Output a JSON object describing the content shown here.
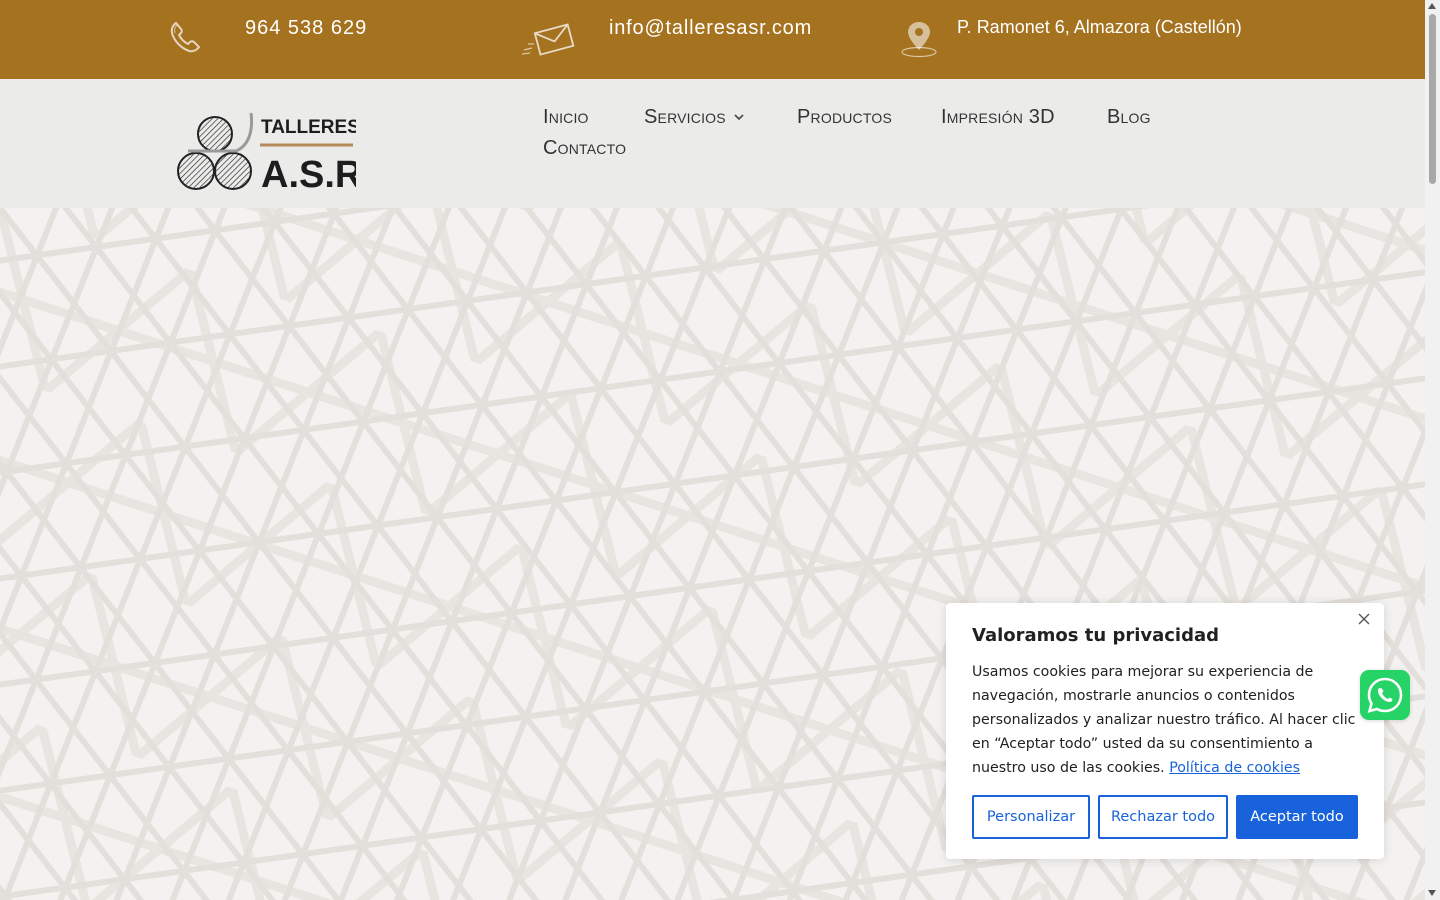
{
  "topbar": {
    "phone": "964 538 629",
    "email": "info@talleresasr.com",
    "address": "P. Ramonet 6, Almazora (Castellón)",
    "icons": [
      "phone-icon",
      "envelope-icon",
      "map-pin-icon"
    ],
    "background_color": "#a57220"
  },
  "logo": {
    "line1": "TALLERES",
    "line2": "A.S.R."
  },
  "nav": {
    "items": [
      "Inicio",
      "Servicios",
      "Productos",
      "Impresión 3D",
      "Blog",
      "Contacto"
    ]
  },
  "cookie": {
    "title": "Valoramos tu privacidad",
    "body": "Usamos cookies para mejorar su experiencia de navegación, mostrarle anuncios o contenidos personalizados y analizar nuestro tráfico. Al hacer clic en “Aceptar todo” usted da su consentimiento a nuestro uso de las cookies.",
    "policy_link": "Política de cookies",
    "buttons": {
      "customize": "Personalizar",
      "reject": "Rechazar todo",
      "accept": "Aceptar todo"
    },
    "accent_color": "#1863dc"
  },
  "whatsapp": {
    "icon": "whatsapp-icon",
    "color": "#25d366"
  }
}
